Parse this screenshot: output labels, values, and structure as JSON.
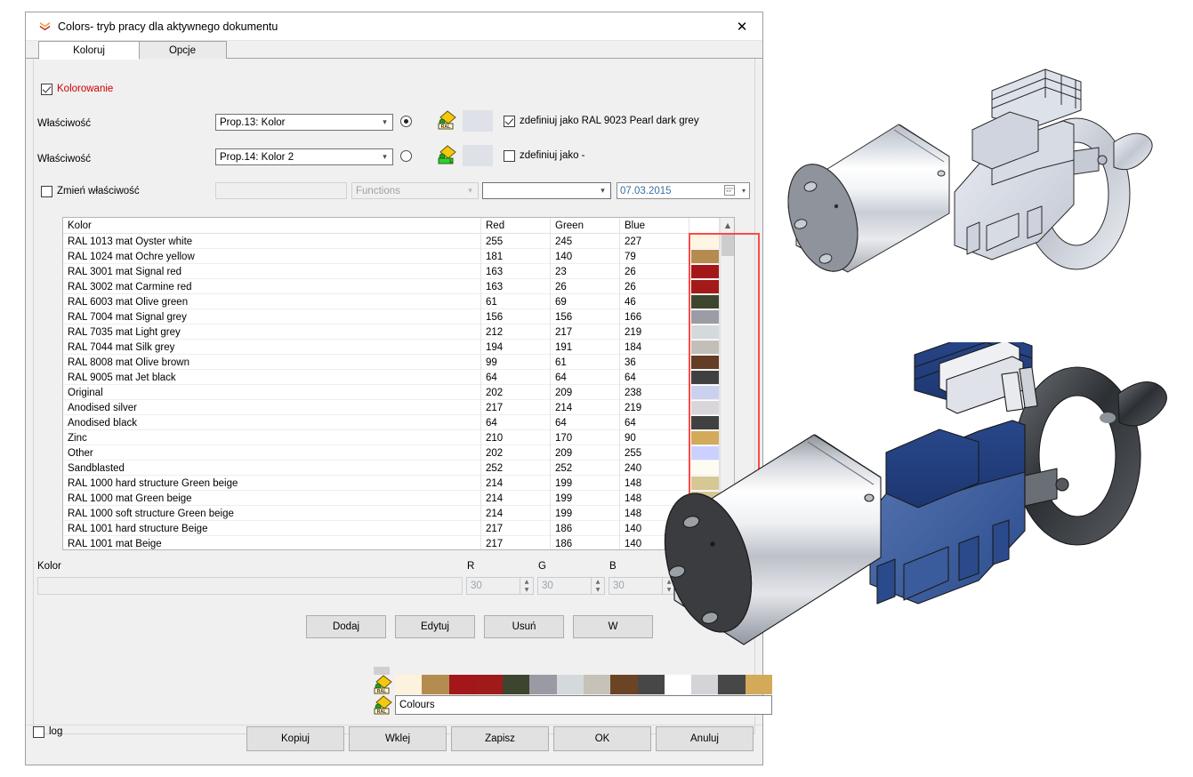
{
  "window": {
    "title": "Colors- tryb pracy dla aktywnego dokumentu",
    "close_label": "✕",
    "icon": "chevrons-down-icon"
  },
  "tabs": [
    {
      "label": "Koloruj",
      "active": true
    },
    {
      "label": "Opcje",
      "active": false
    }
  ],
  "form": {
    "colorize_label": "Kolorowanie",
    "colorize_checked": true,
    "colorize_color": "#cc0000",
    "property1_label": "Właściwość",
    "property1_value": "Prop.13: Kolor",
    "property1_radio_on": true,
    "property2_label": "Właściwość",
    "property2_value": "Prop.14: Kolor 2",
    "property2_radio_on": false,
    "define_as_1_label": "zdefiniuj jako RAL 9023 Pearl dark grey",
    "define_as_1_checked": true,
    "define_as_2_label": "zdefiniuj jako  -",
    "define_as_2_checked": false,
    "change_property_label": "Zmień właściwość",
    "change_property_checked": false,
    "change_property_value": "",
    "functions_value": "Functions",
    "extra_combo_value": "",
    "date_value": "07.03.2015",
    "preview1_color": "#dee1e8",
    "preview2_color": "#dee1e8"
  },
  "table": {
    "columns": [
      "Kolor",
      "Red",
      "Green",
      "Blue"
    ],
    "rows": [
      {
        "name": "RAL 1013 mat Oyster white",
        "r": 255,
        "g": 245,
        "b": 227,
        "hex": "#fff5e3"
      },
      {
        "name": "RAL 1024 mat Ochre yellow",
        "r": 181,
        "g": 140,
        "b": 79,
        "hex": "#b58c4f"
      },
      {
        "name": "RAL 3001 mat Signal red",
        "r": 163,
        "g": 23,
        "b": 26,
        "hex": "#a3171a"
      },
      {
        "name": "RAL 3002 mat Carmine red",
        "r": 163,
        "g": 26,
        "b": 26,
        "hex": "#a31a1a"
      },
      {
        "name": "RAL 6003 mat Olive green",
        "r": 61,
        "g": 69,
        "b": 46,
        "hex": "#3d452e"
      },
      {
        "name": "RAL 7004 mat Signal grey",
        "r": 156,
        "g": 156,
        "b": 166,
        "hex": "#9c9ca6"
      },
      {
        "name": "RAL 7035 mat Light grey",
        "r": 212,
        "g": 217,
        "b": 219,
        "hex": "#d4d9db"
      },
      {
        "name": "RAL 7044 mat Silk grey",
        "r": 194,
        "g": 191,
        "b": 184,
        "hex": "#c2bfb8"
      },
      {
        "name": "RAL 8008 mat Olive brown",
        "r": 99,
        "g": 61,
        "b": 36,
        "hex": "#633d24"
      },
      {
        "name": "RAL 9005 mat Jet black",
        "r": 64,
        "g": 64,
        "b": 64,
        "hex": "#404040"
      },
      {
        "name": "Original",
        "r": 202,
        "g": 209,
        "b": 238,
        "hex": "#cad1ee"
      },
      {
        "name": "Anodised silver",
        "r": 217,
        "g": 214,
        "b": 219,
        "hex": "#d9d6db"
      },
      {
        "name": "Anodised black",
        "r": 64,
        "g": 64,
        "b": 64,
        "hex": "#404040"
      },
      {
        "name": "Zinc",
        "r": 210,
        "g": 170,
        "b": 90,
        "hex": "#d2aa5a"
      },
      {
        "name": "Other",
        "r": 202,
        "g": 209,
        "b": 255,
        "hex": "#cad1ff"
      },
      {
        "name": "Sandblasted",
        "r": 252,
        "g": 252,
        "b": 240,
        "hex": "#fcfcf0"
      },
      {
        "name": "RAL 1000 hard structure Green beige",
        "r": 214,
        "g": 199,
        "b": 148,
        "hex": "#d6c794"
      },
      {
        "name": "RAL 1000 mat Green beige",
        "r": 214,
        "g": 199,
        "b": 148,
        "hex": "#d6c794"
      },
      {
        "name": "RAL 1000 soft structure Green beige",
        "r": 214,
        "g": 199,
        "b": 148,
        "hex": "#d6c794"
      },
      {
        "name": "RAL 1001 hard structure Beige",
        "r": 217,
        "g": 186,
        "b": 140,
        "hex": "#d9ba8c"
      },
      {
        "name": "RAL 1001 mat Beige",
        "r": 217,
        "g": 186,
        "b": 140,
        "hex": "#d9ba8c"
      }
    ],
    "highlight_color": "#fc4a46"
  },
  "editor": {
    "color_label": "Kolor",
    "color_value": "",
    "r_label": "R",
    "g_label": "G",
    "b_label": "B",
    "r_value": "30",
    "g_value": "30",
    "b_value": "30"
  },
  "actions": {
    "add": "Dodaj",
    "edit": "Edytuj",
    "delete": "Usuń",
    "more": "W"
  },
  "palette": {
    "colours_label": "Colours",
    "swatches": [
      "#fdf2dd",
      "#b58c4f",
      "#a3171a",
      "#a01a1a",
      "#3d452e",
      "#9a9aa4",
      "#d4d9db",
      "#c6c2b8",
      "#6b4426",
      "#474747",
      "#ffffff",
      "#d3d3d8",
      "#474747",
      "#d2aa5a"
    ]
  },
  "footer": {
    "log_label": "log",
    "log_checked": false,
    "copy": "Kopiuj",
    "paste": "Wklej",
    "save": "Zapisz",
    "ok": "OK",
    "cancel": "Anuluj"
  }
}
